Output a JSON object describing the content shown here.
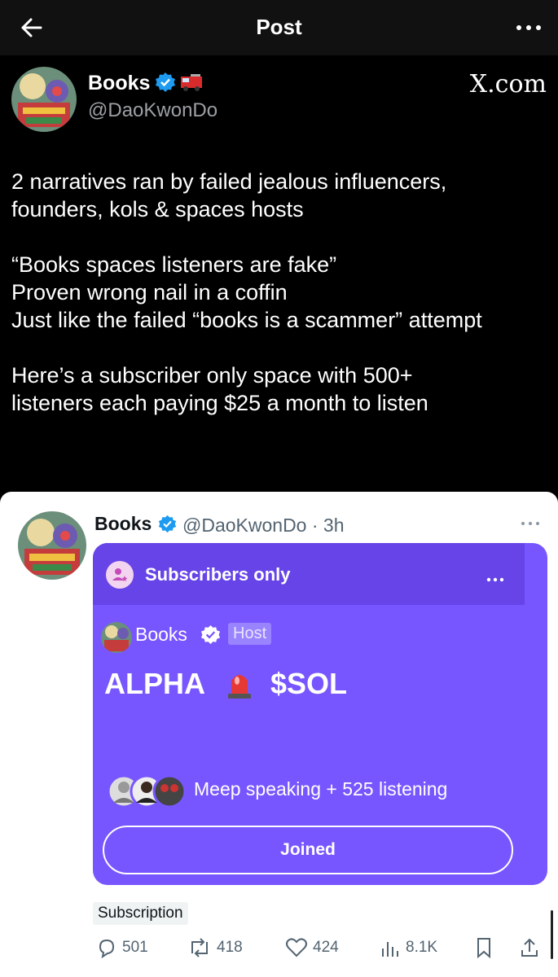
{
  "topbar": {
    "title": "Post"
  },
  "author": {
    "name": "Books",
    "handle": "@DaoKwonDo",
    "site": "X.com"
  },
  "post": {
    "text": "2 narratives ran by failed jealous influencers,\nfounders, kols & spaces hosts\n\n“Books spaces listeners are fake”\nProven wrong nail in a coffin\nJust like the failed  “books is a scammer” attempt\n\nHere’s a subscriber only space with 500+\nlisteners each paying $25 a month to listen"
  },
  "embedded": {
    "name": "Books",
    "handle_time": "@DaoKwonDo · 3h",
    "space": {
      "banner": "Subscribers only",
      "host_name": "Books",
      "host_badge": "Host",
      "title_left": "ALPHA",
      "title_right": "$SOL",
      "listeners_text": "Meep speaking + 525 listening",
      "joined_label": "Joined"
    },
    "subscription_label": "Subscription"
  },
  "actions": {
    "replies": "501",
    "reposts": "418",
    "likes": "424",
    "views": "8.1K"
  },
  "colors": {
    "space_bg": "#7856ff",
    "space_header": "#6644e8",
    "verified": "#1d9bf0",
    "secondary_text": "#536471"
  }
}
